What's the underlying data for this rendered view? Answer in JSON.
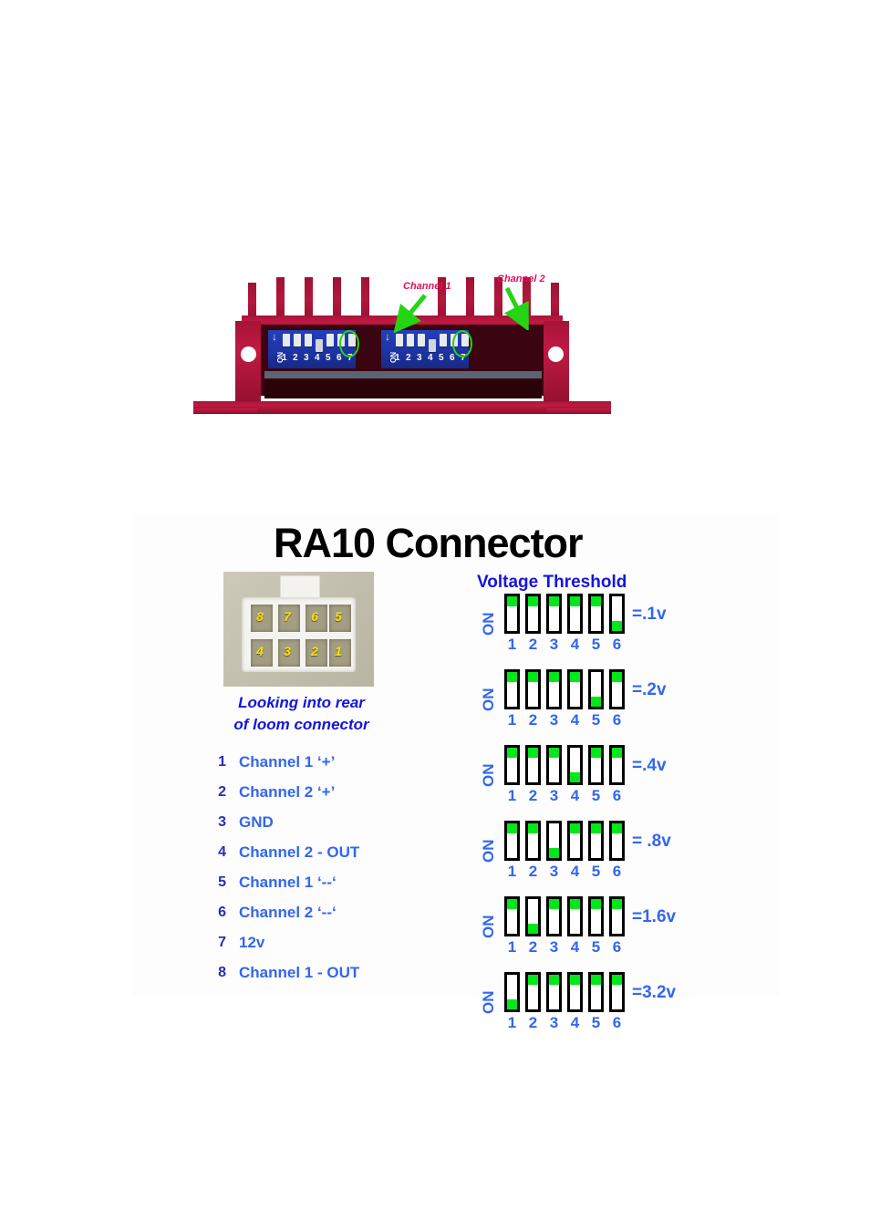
{
  "photo": {
    "caption_channel_1": "Channel 1",
    "caption_channel_2": "Channel 2",
    "dip_on_label": "ON",
    "dip_numbers": [
      "1",
      "2",
      "3",
      "4",
      "5",
      "6",
      "7"
    ],
    "colors": {
      "heatsink": "#a61338",
      "dip_pack": "#1d34a4",
      "callout_text": "#e1125f",
      "callout_arrow": "#25d413"
    }
  },
  "panel": {
    "title": "RA10 Connector",
    "connector": {
      "pins_top": [
        "8",
        "7",
        "6",
        "5"
      ],
      "pins_bottom": [
        "4",
        "3",
        "2",
        "1"
      ],
      "caption_line1": "Looking into rear",
      "caption_line2": "of loom connector",
      "number_color": "#ffe000"
    },
    "pinout": {
      "rows": [
        {
          "num": "1",
          "label": "Channel 1 ‘+’"
        },
        {
          "num": "2",
          "label": "Channel 2 ‘+’"
        },
        {
          "num": "3",
          "label": "GND"
        },
        {
          "num": "4",
          "label": "Channel 2 - OUT"
        },
        {
          "num": "5",
          "label": "Channel 1 ‘--‘"
        },
        {
          "num": "6",
          "label": "Channel 2 ‘--‘"
        },
        {
          "num": "7",
          "label": "12v"
        },
        {
          "num": "8",
          "label": "Channel 1 - OUT"
        }
      ]
    },
    "voltage_threshold": {
      "heading": "Voltage Threshold",
      "on_label": "ON",
      "switch_numbers": [
        "1",
        "2",
        "3",
        "4",
        "5",
        "6"
      ],
      "colors": {
        "knob": "#00e818",
        "text": "#3366ee"
      },
      "rows": [
        {
          "value": "=.1v",
          "states": [
            "up",
            "up",
            "up",
            "up",
            "up",
            "down"
          ]
        },
        {
          "value": "=.2v",
          "states": [
            "up",
            "up",
            "up",
            "up",
            "down",
            "up"
          ]
        },
        {
          "value": "=.4v",
          "states": [
            "up",
            "up",
            "up",
            "down",
            "up",
            "up"
          ]
        },
        {
          "value": "= .8v",
          "states": [
            "up",
            "up",
            "down",
            "up",
            "up",
            "up"
          ]
        },
        {
          "value": "=1.6v",
          "states": [
            "up",
            "down",
            "up",
            "up",
            "up",
            "up"
          ]
        },
        {
          "value": "=3.2v",
          "states": [
            "down",
            "up",
            "up",
            "up",
            "up",
            "up"
          ]
        }
      ]
    }
  }
}
